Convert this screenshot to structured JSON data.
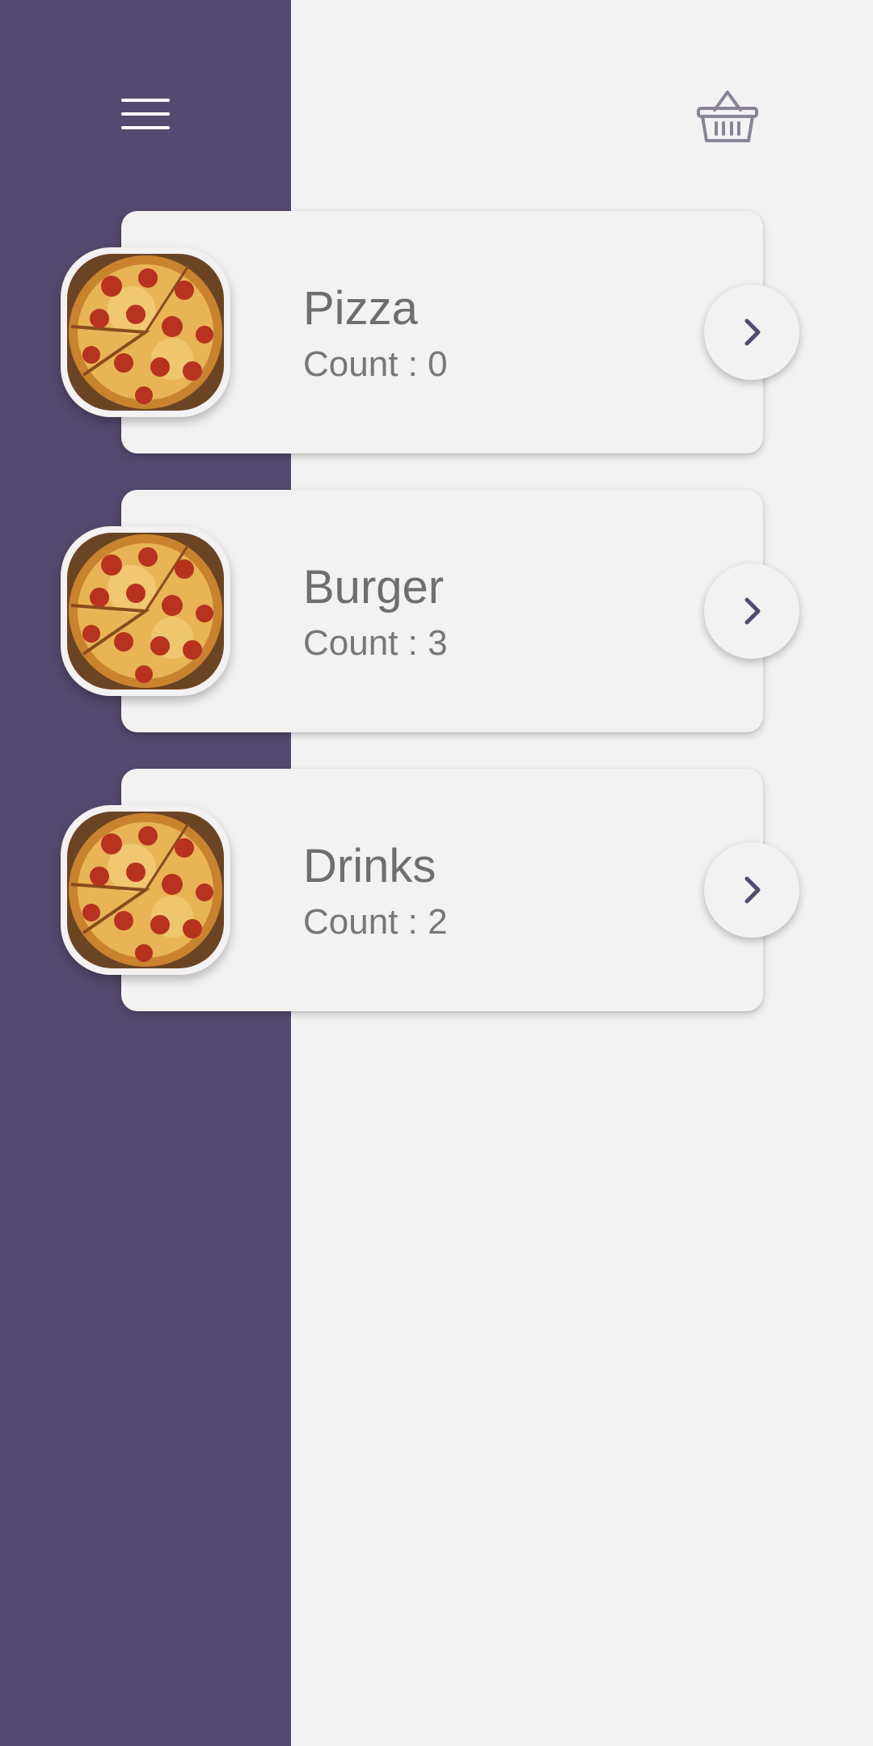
{
  "app": {
    "accent_color": "#54496e",
    "background_color": "#f2f2f2"
  },
  "header": {
    "menu_icon": "hamburger-menu-icon",
    "cart_icon": "shopping-basket-icon"
  },
  "categories": [
    {
      "title": "Pizza",
      "count_text": "Count : 0",
      "image": "pizza-thumbnail",
      "action_icon": "chevron-right-icon"
    },
    {
      "title": "Burger",
      "count_text": "Count : 3",
      "image": "pizza-thumbnail",
      "action_icon": "chevron-right-icon"
    },
    {
      "title": "Drinks",
      "count_text": "Count : 2",
      "image": "pizza-thumbnail",
      "action_icon": "chevron-right-icon"
    }
  ]
}
